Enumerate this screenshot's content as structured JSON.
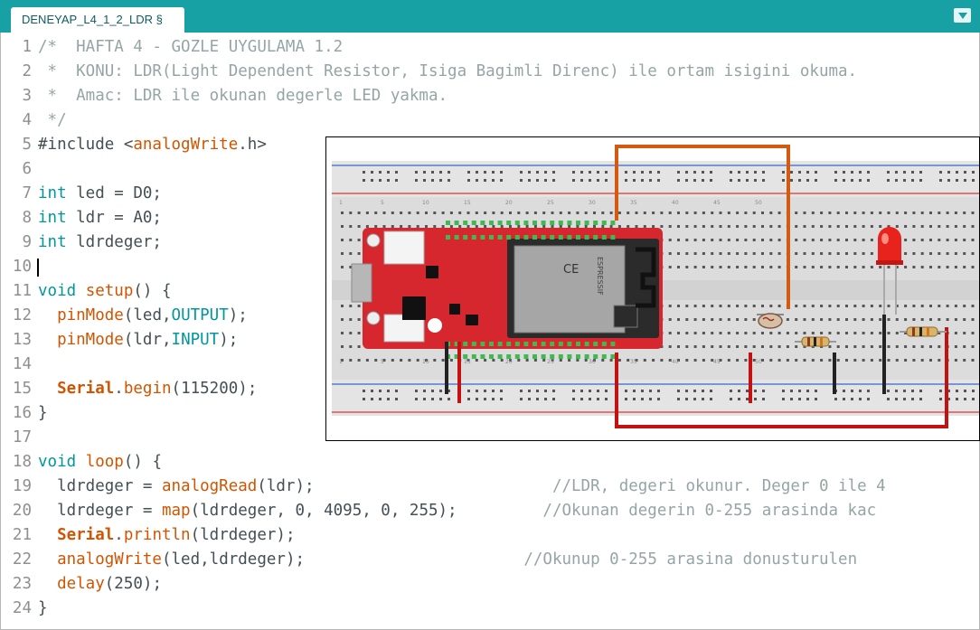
{
  "tab": {
    "title": "DENEYAP_L4_1_2_LDR §"
  },
  "lines": [
    {
      "n": "1",
      "parts": [
        {
          "t": "/*  HAFTA 4 - GOZLE UYGULAMA 1.2",
          "c": "cmt"
        }
      ]
    },
    {
      "n": "2",
      "parts": [
        {
          "t": " *  KONU: LDR(Light Dependent Resistor, Isiga Bagimli Direnc) ile ortam isigini okuma.",
          "c": "cmt"
        }
      ]
    },
    {
      "n": "3",
      "parts": [
        {
          "t": " *  Amac: LDR ile okunan degerle LED yakma.",
          "c": "cmt"
        }
      ]
    },
    {
      "n": "4",
      "parts": [
        {
          "t": " */",
          "c": "cmt"
        }
      ]
    },
    {
      "n": "5",
      "parts": [
        {
          "t": "#include <",
          "c": ""
        },
        {
          "t": "analogWrite",
          "c": "fn"
        },
        {
          "t": ".h>",
          "c": ""
        }
      ]
    },
    {
      "n": "6",
      "parts": []
    },
    {
      "n": "7",
      "parts": [
        {
          "t": "int",
          "c": "kw"
        },
        {
          "t": " led = D0;",
          "c": ""
        }
      ]
    },
    {
      "n": "8",
      "parts": [
        {
          "t": "int",
          "c": "kw"
        },
        {
          "t": " ldr = A0;",
          "c": ""
        }
      ]
    },
    {
      "n": "9",
      "parts": [
        {
          "t": "int",
          "c": "kw"
        },
        {
          "t": " ldrdeger;",
          "c": ""
        }
      ]
    },
    {
      "n": "10",
      "parts": []
    },
    {
      "n": "11",
      "parts": [
        {
          "t": "void",
          "c": "kw"
        },
        {
          "t": " ",
          "c": ""
        },
        {
          "t": "setup",
          "c": "fn"
        },
        {
          "t": "() {",
          "c": ""
        }
      ]
    },
    {
      "n": "12",
      "parts": [
        {
          "t": "  ",
          "c": ""
        },
        {
          "t": "pinMode",
          "c": "fn"
        },
        {
          "t": "(led,",
          "c": ""
        },
        {
          "t": "OUTPUT",
          "c": "kw"
        },
        {
          "t": ");",
          "c": ""
        }
      ]
    },
    {
      "n": "13",
      "parts": [
        {
          "t": "  ",
          "c": ""
        },
        {
          "t": "pinMode",
          "c": "fn"
        },
        {
          "t": "(ldr,",
          "c": ""
        },
        {
          "t": "INPUT",
          "c": "kw"
        },
        {
          "t": ");",
          "c": ""
        }
      ]
    },
    {
      "n": "14",
      "parts": []
    },
    {
      "n": "15",
      "parts": [
        {
          "t": "  ",
          "c": ""
        },
        {
          "t": "Serial",
          "c": "bold"
        },
        {
          "t": ".",
          "c": ""
        },
        {
          "t": "begin",
          "c": "fn"
        },
        {
          "t": "(115200);",
          "c": ""
        }
      ]
    },
    {
      "n": "16",
      "parts": [
        {
          "t": "}",
          "c": ""
        }
      ]
    },
    {
      "n": "17",
      "parts": []
    },
    {
      "n": "18",
      "parts": [
        {
          "t": "void",
          "c": "kw"
        },
        {
          "t": " ",
          "c": ""
        },
        {
          "t": "loop",
          "c": "fn"
        },
        {
          "t": "() {",
          "c": ""
        }
      ]
    },
    {
      "n": "19",
      "parts": [
        {
          "t": "  ldrdeger = ",
          "c": ""
        },
        {
          "t": "analogRead",
          "c": "fn"
        },
        {
          "t": "(ldr);                         ",
          "c": ""
        },
        {
          "t": "//LDR, degeri okunur. Deger 0 ile 4",
          "c": "cmt"
        }
      ]
    },
    {
      "n": "20",
      "parts": [
        {
          "t": "  ldrdeger = ",
          "c": ""
        },
        {
          "t": "map",
          "c": "fn"
        },
        {
          "t": "(ldrdeger, 0, 4095, 0, 255);         ",
          "c": ""
        },
        {
          "t": "//Okunan degerin 0-255 arasinda kac",
          "c": "cmt"
        }
      ]
    },
    {
      "n": "21",
      "parts": [
        {
          "t": "  ",
          "c": ""
        },
        {
          "t": "Serial",
          "c": "bold"
        },
        {
          "t": ".",
          "c": ""
        },
        {
          "t": "println",
          "c": "fn"
        },
        {
          "t": "(ldrdeger);",
          "c": ""
        }
      ]
    },
    {
      "n": "22",
      "parts": [
        {
          "t": "  ",
          "c": ""
        },
        {
          "t": "analogWrite",
          "c": "fn"
        },
        {
          "t": "(led,ldrdeger);                       ",
          "c": ""
        },
        {
          "t": "//Okunup 0-255 arasina donusturulen",
          "c": "cmt"
        }
      ]
    },
    {
      "n": "23",
      "parts": [
        {
          "t": "  ",
          "c": ""
        },
        {
          "t": "delay",
          "c": "fn"
        },
        {
          "t": "(250);",
          "c": ""
        }
      ]
    },
    {
      "n": "24",
      "parts": [
        {
          "t": "}",
          "c": ""
        }
      ]
    }
  ],
  "circuit": {
    "board_label": "ESPRESSIF",
    "ce_mark": "CE",
    "column_numbers": [
      "1",
      "5",
      "10",
      "15",
      "20",
      "25",
      "30",
      "35",
      "40",
      "45",
      "50"
    ],
    "colors": {
      "board": "#d6262e",
      "wire_orange": "#d35a10",
      "wire_red": "#c41212",
      "wire_black": "#222222",
      "led": "#e8221c",
      "rail_blue": "#3a66c9",
      "rail_red": "#d8383a"
    }
  }
}
